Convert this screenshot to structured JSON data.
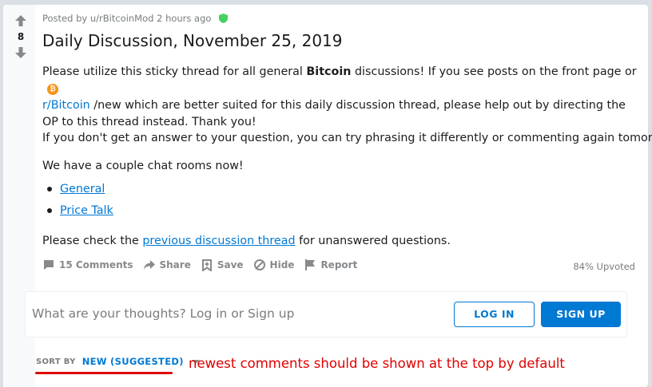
{
  "vote": {
    "count": "8"
  },
  "post": {
    "meta": "Posted by u/rBitcoinMod 2 hours ago",
    "title": "Daily Discussion, November 25, 2019",
    "p1_a": "Please utilize this sticky thread for all general ",
    "p1_bold": "Bitcoin",
    "p1_b": " discussions! If you see posts on the front page or ",
    "p1_link": "r/Bitcoin",
    "p1_c": " /new which are better suited for this daily discussion thread, please help out by directing the OP to this thread instead. Thank you!",
    "p2": "If you don't get an answer to your question, you can try phrasing it differently or commenting again tomorrow.",
    "p3": "We have a couple chat rooms now!",
    "chat_rooms": [
      "General",
      "Price Talk"
    ],
    "p4_a": "Please check the ",
    "p4_link": "previous discussion thread",
    "p4_b": " for unanswered questions."
  },
  "actions": {
    "comments": "15 Comments",
    "share": "Share",
    "save": "Save",
    "hide": "Hide",
    "report": "Report",
    "upvoted": "84% Upvoted"
  },
  "comment_box": {
    "prompt": "What are your thoughts? Log in or Sign up",
    "login": "LOG IN",
    "signup": "SIGN UP"
  },
  "sort": {
    "label": "SORT BY",
    "value": "NEW (SUGGESTED)"
  },
  "annotation": "newest comments should be shown at the top by default",
  "colors": {
    "accent": "#0079d3",
    "annotation": "#e00000",
    "bitcoin": "#f7931a",
    "mod_shield": "#46d160"
  },
  "icons": {
    "subreddit": "bitcoin-icon",
    "moderator": "shield-icon"
  }
}
